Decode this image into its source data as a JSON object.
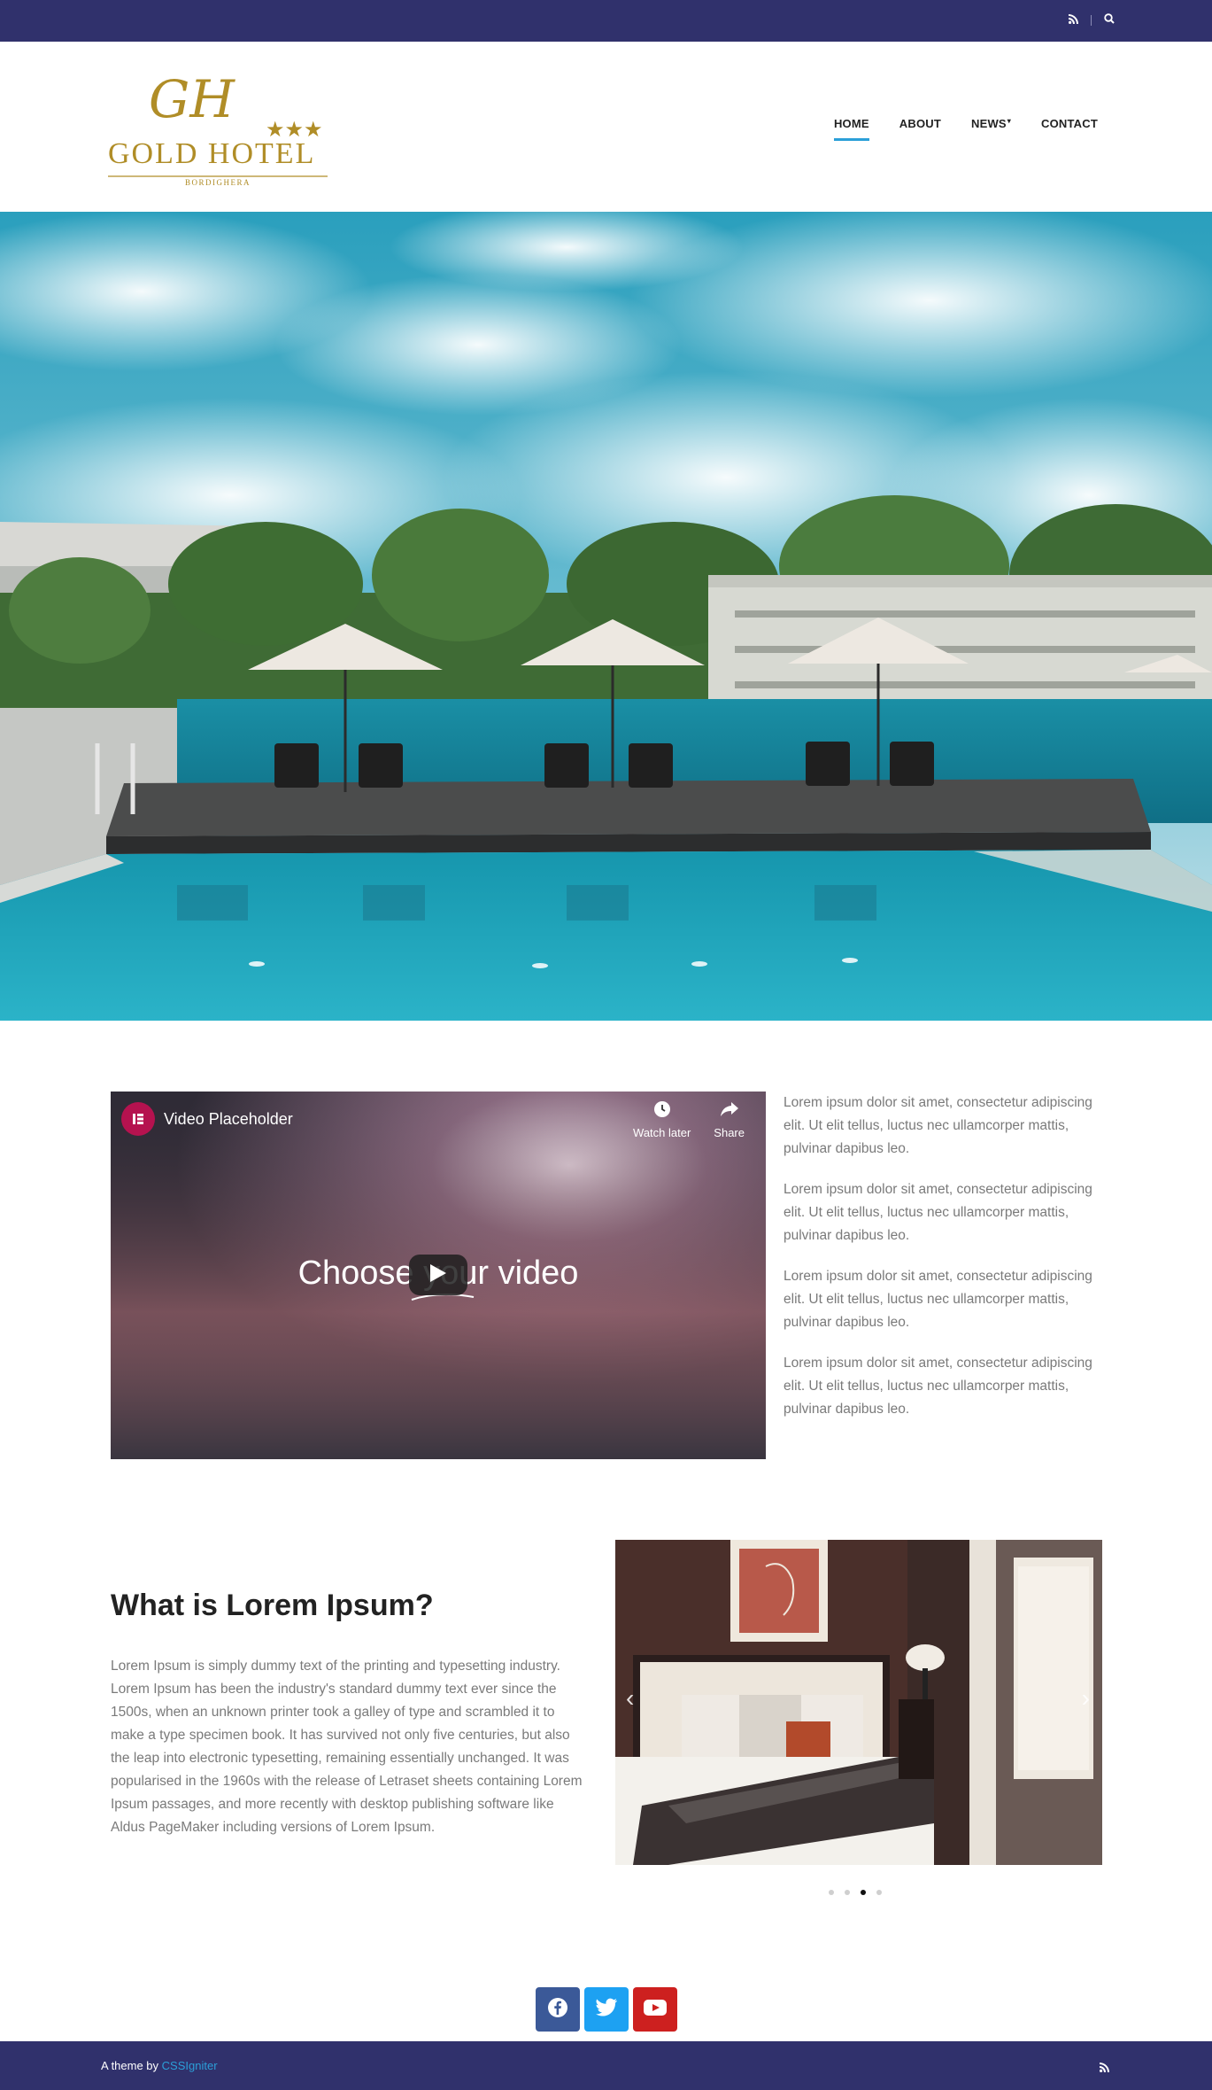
{
  "topbar": {
    "icons": [
      "rss-icon",
      "search-icon"
    ]
  },
  "brand": {
    "monogram": "GH",
    "name": "GOLD HOTEL",
    "location": "BORDIGHERA",
    "stars": "★★★",
    "color": "#b08d27"
  },
  "nav": {
    "items": [
      {
        "label": "HOME",
        "active": true
      },
      {
        "label": "ABOUT",
        "active": false
      },
      {
        "label": "NEWS",
        "active": false,
        "has_dropdown": true
      },
      {
        "label": "CONTACT",
        "active": false
      }
    ]
  },
  "video": {
    "channel": "Video Placeholder",
    "watch_later": "Watch later",
    "share": "Share",
    "title": "Choose your video"
  },
  "side_text": [
    "Lorem ipsum dolor sit amet, consectetur adipiscing elit. Ut elit tellus, luctus nec ullamcorper mattis, pulvinar dapibus leo.",
    "Lorem ipsum dolor sit amet, consectetur adipiscing elit. Ut elit tellus, luctus nec ullamcorper mattis, pulvinar dapibus leo.",
    "Lorem ipsum dolor sit amet, consectetur adipiscing elit. Ut elit tellus, luctus nec ullamcorper mattis, pulvinar dapibus leo.",
    "Lorem ipsum dolor sit amet, consectetur adipiscing elit. Ut elit tellus, luctus nec ullamcorper mattis, pulvinar dapibus leo."
  ],
  "about": {
    "title": "What is Lorem Ipsum?",
    "body": "Lorem Ipsum is simply dummy text of the printing and typesetting industry. Lorem Ipsum has been the industry's standard dummy text ever since the 1500s, when an unknown printer took a galley of type and scrambled it to make a type specimen book. It has survived not only five centuries, but also the leap into electronic typesetting, remaining essentially unchanged. It was popularised in the 1960s with the release of Letraset sheets containing Lorem Ipsum passages, and more recently with desktop publishing software like Aldus PageMaker including versions of Lorem Ipsum."
  },
  "slider": {
    "slide_count": 4,
    "active_index": 2
  },
  "social": [
    {
      "name": "facebook-icon",
      "color": "#3b5998"
    },
    {
      "name": "twitter-icon",
      "color": "#1da1f2"
    },
    {
      "name": "youtube-icon",
      "color": "#cd201f"
    }
  ],
  "footer": {
    "credit_prefix": "A theme by",
    "credit_link": "CSSIgniter"
  },
  "colors": {
    "topbar": "#30316c",
    "accent": "#2b9fd8",
    "body_text": "#7a7a7a"
  }
}
